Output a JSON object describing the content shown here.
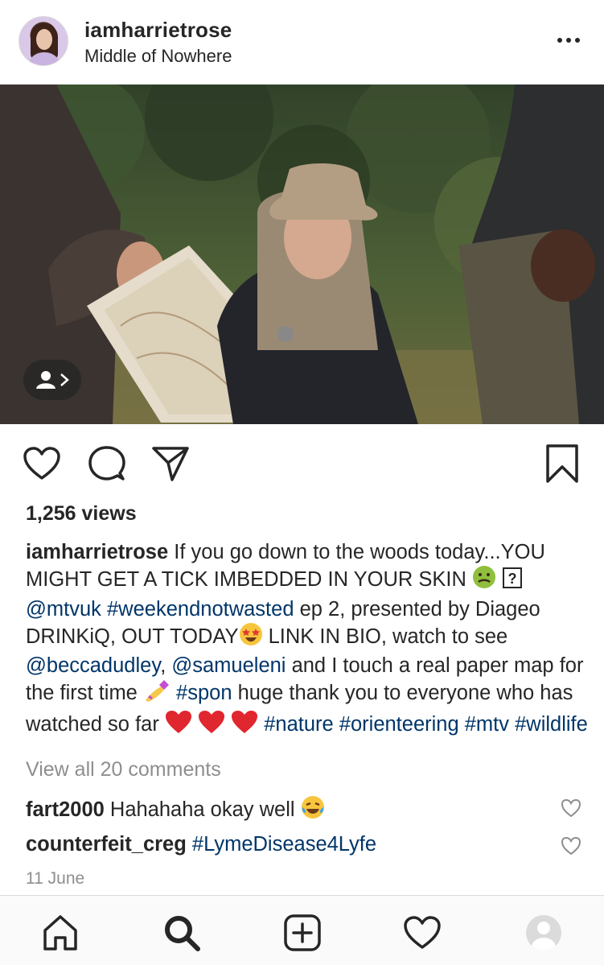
{
  "post": {
    "username": "iamharrietrose",
    "location": "Middle of Nowhere",
    "views": "1,256 views",
    "caption": {
      "username": "iamharrietrose",
      "t1": " If you go down to the woods today...YOU MIGHT GET A TICK IMBEDDED IN YOUR SKIN ",
      "unknown_glyph": "?",
      "mention_mtvuk": "@mtvuk",
      "hashtag_weekendnotwasted": "#weekendnotwasted",
      "t2": " ep 2, presented by Diageo DRINKiQ, OUT TODAY",
      "t3": " LINK IN BIO, watch to see ",
      "mention_beccadudley": "@beccadudley",
      "t4": ", ",
      "mention_samueleni": "@samueleni",
      "t5": " and I touch a real paper map for the first time ",
      "hashtag_spon": "#spon",
      "t6": " huge thank you to everyone who has watched so far ",
      "hashtag_nature": "#nature",
      "hashtag_orienteering": "#orienteering",
      "hashtag_mtv": "#mtv",
      "hashtag_wildlife": "#wildlife"
    },
    "view_all_comments": "View all 20 comments",
    "comments": [
      {
        "username": "fart2000",
        "text": " Hahahaha okay well "
      },
      {
        "username": "counterfeit_creg",
        "text": "#LymeDisease4Lyfe"
      }
    ],
    "date": "11 June"
  },
  "icons": {
    "more": "more-options-icon",
    "tag": "user-tag-icon",
    "like": "heart-icon",
    "comment": "comment-icon",
    "share": "send-icon",
    "save": "bookmark-icon",
    "home": "home-icon",
    "search": "search-icon",
    "new_post": "add-post-icon",
    "activity": "activity-heart-icon",
    "profile": "profile-icon"
  },
  "colors": {
    "text": "#262626",
    "link": "#003569",
    "muted": "#8e8e8e",
    "nav_background": "#fafafa",
    "divider": "#dbdbdb"
  }
}
